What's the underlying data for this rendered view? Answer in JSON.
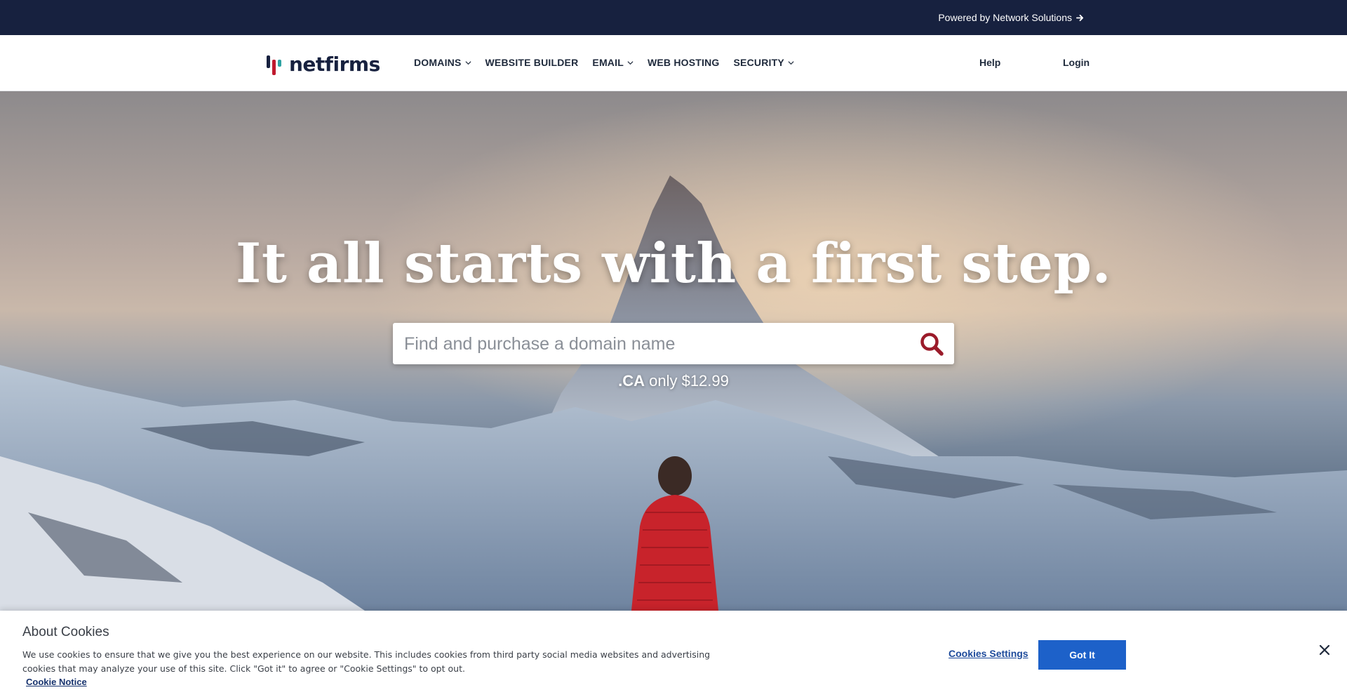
{
  "topbar": {
    "powered_label": "Powered by Network Solutions",
    "arrow_icon": "arrow-right-icon"
  },
  "nav": {
    "logo_text": "netfirms",
    "items": [
      {
        "label": "DOMAINS",
        "has_dropdown": true
      },
      {
        "label": "WEBSITE BUILDER",
        "has_dropdown": false
      },
      {
        "label": "EMAIL",
        "has_dropdown": true
      },
      {
        "label": "WEB HOSTING",
        "has_dropdown": false
      },
      {
        "label": "SECURITY",
        "has_dropdown": true
      }
    ],
    "help_label": "Help",
    "login_label": "Login"
  },
  "hero": {
    "title": "It all starts with a first step.",
    "search_placeholder": "Find and purchase a domain name",
    "search_icon": "search-icon",
    "promo_tld": ".CA",
    "promo_text": " only $12.99"
  },
  "cookie_banner": {
    "title": "About Cookies",
    "text": "We use cookies to ensure that we give you the best experience on our website. This includes cookies from third party social media websites and advertising cookies that may analyze your use of this site. Click \"Got it\" to agree or \"Cookie Settings\" to opt out.",
    "notice_link": "Cookie Notice",
    "settings_label": "Cookies Settings",
    "accept_label": "Got It",
    "close_icon": "close-icon"
  },
  "colors": {
    "topbar_bg": "#17213f",
    "brand_red": "#c0192e",
    "brand_teal": "#2fa3a3",
    "search_icon": "#9b1b2a",
    "accept_button": "#1d61c9"
  }
}
